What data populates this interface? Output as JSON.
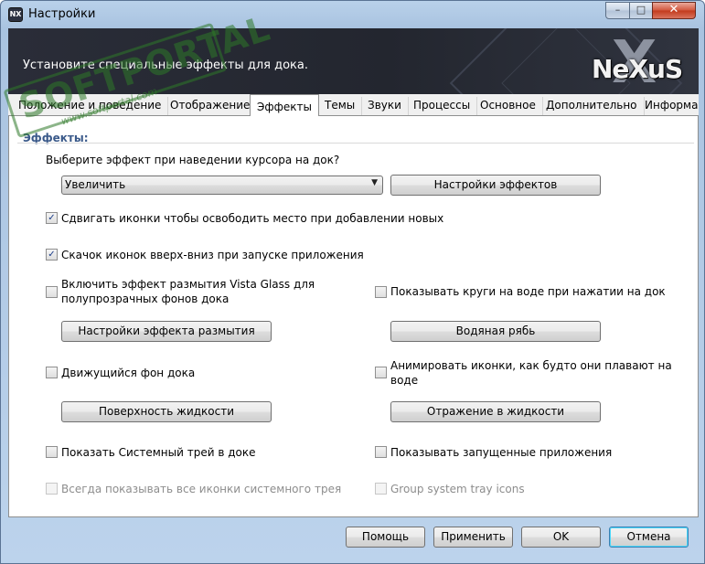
{
  "window": {
    "title": "Настройки",
    "app_icon_label": "NX",
    "controls": {
      "minimize": "–",
      "maximize": "□",
      "close": "✕"
    }
  },
  "header": {
    "description": "Установите специальные эффекты для дока.",
    "logo_text": "NeXuS"
  },
  "watermark": {
    "text": "SOFTPORTAL",
    "url": "www.softportal.com"
  },
  "tabs": [
    {
      "label": "Положение и поведение"
    },
    {
      "label": "Отображение"
    },
    {
      "label": "Эффекты"
    },
    {
      "label": "Темы"
    },
    {
      "label": "Звуки"
    },
    {
      "label": "Процессы"
    },
    {
      "label": "Основное"
    },
    {
      "label": "Дополнительно"
    },
    {
      "label": "Информация"
    }
  ],
  "active_tab": "Эффекты",
  "effects": {
    "group_title": "Эффекты:",
    "hover_prompt": "Выберите эффект при наведении курсора на док?",
    "hover_effect": {
      "selected": "Увеличить"
    },
    "effect_settings_button": "Настройки эффектов",
    "shift_icons": {
      "label": "Сдвигать иконки чтобы освободить место при добавлении новых",
      "checked": true
    },
    "bounce_icons": {
      "label": "Скачок иконок вверх-вниз при запуске приложения",
      "checked": true
    },
    "vista_glass": {
      "label_line1": "Включить эффект размытия Vista Glass для",
      "label_line2": "полупрозрачных фонов дока",
      "checked": false
    },
    "water_ripple": {
      "label": "Показывать круги на воде при нажатии на док",
      "checked": false
    },
    "blur_settings_button": "Настройки эффекта размытия",
    "water_ripple_button": "Водяная рябь",
    "moving_background": {
      "label": "Движущийся фон дока",
      "checked": false
    },
    "floating_icons": {
      "label_line1": "Анимировать иконки, как будто они плавают на",
      "label_line2": "воде",
      "checked": false
    },
    "liquid_surface_button": "Поверхность жидкости",
    "liquid_reflection_button": "Отражение в жидкости",
    "system_tray": {
      "label": "Показать Системный трей в доке",
      "checked": false
    },
    "running_apps": {
      "label": "Показывать запущенные приложения",
      "checked": false
    },
    "all_tray_icons": {
      "label": "Всегда показывать все иконки системного трея",
      "checked": false,
      "disabled": true
    },
    "group_tray_icons": {
      "label": "Group system tray icons",
      "checked": false,
      "disabled": true
    },
    "check_glyph": "✓",
    "dropdown_arrow": "▼"
  },
  "footer": {
    "help": "Помощь",
    "apply": "Применить",
    "ok": "OK",
    "cancel": "Отмена"
  }
}
